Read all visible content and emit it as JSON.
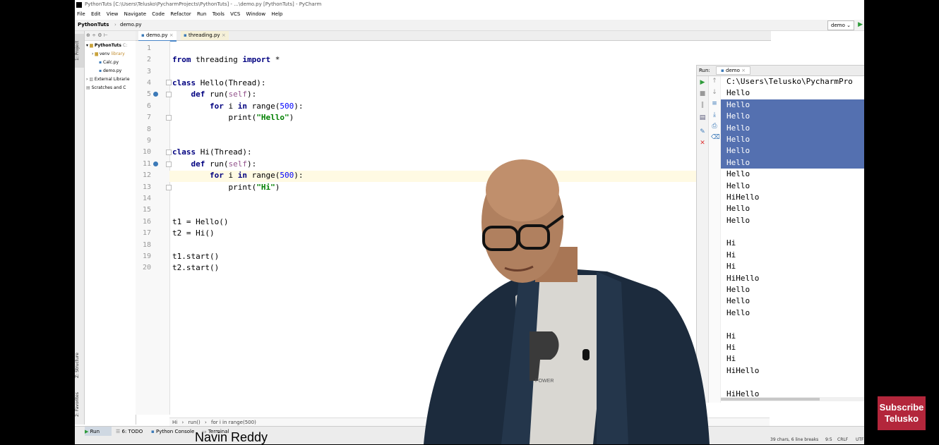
{
  "window": {
    "title": "PythonTuts [C:\\Users\\Telusko\\PycharmProjects\\PythonTuts] - ...\\demo.py [PythonTuts] - PyCharm"
  },
  "menu": [
    "File",
    "Edit",
    "View",
    "Navigate",
    "Code",
    "Refactor",
    "Run",
    "Tools",
    "VCS",
    "Window",
    "Help"
  ],
  "nav": {
    "project": "PythonTuts",
    "file": "demo.py",
    "run_config": "demo"
  },
  "side_tabs": {
    "project": "1: Project",
    "structure": "Z: Structure",
    "favorites": "2: Favorites"
  },
  "project_tree": {
    "root": "PythonTuts",
    "root_path": "C:",
    "venv": "venv",
    "venv_suffix": "library",
    "files": [
      "Calc.py",
      "demo.py"
    ],
    "external": "External Librarie",
    "scratches": "Scratches and C"
  },
  "editor_tabs": [
    {
      "label": "demo.py",
      "active": true
    },
    {
      "label": "threading.py",
      "active": false
    }
  ],
  "line_numbers": [
    "1",
    "2",
    "3",
    "4",
    "5",
    "6",
    "7",
    "8",
    "9",
    "10",
    "11",
    "12",
    "13",
    "14",
    "15",
    "16",
    "17",
    "18",
    "19",
    "20"
  ],
  "code": {
    "l2_a": "from",
    "l2_b": " threading ",
    "l2_c": "import",
    "l2_d": " *",
    "l4_a": "class",
    "l4_b": " Hello(Thread):",
    "l5_a": "def",
    "l5_b": " run(",
    "l5_c": "self",
    "l5_d": "):",
    "l6_a": "for",
    "l6_b": " i ",
    "l6_c": "in",
    "l6_d": " range(",
    "l6_e": "500",
    "l6_f": "):",
    "l7_a": "print(",
    "l7_b": "\"Hello\"",
    "l7_c": ")",
    "l10_a": "class",
    "l10_b": " Hi(Thread):",
    "l11_a": "def",
    "l11_b": " run(",
    "l11_c": "self",
    "l11_d": "):",
    "l12_a": "for",
    "l12_b": " i ",
    "l12_c": "in",
    "l12_d": " range(",
    "l12_e": "500",
    "l12_f": "):",
    "l13_a": "print(",
    "l13_b": "\"Hi\"",
    "l13_c": ")",
    "l16": "t1 = Hello()",
    "l17": "t2 = Hi()",
    "l19": "t1.start()",
    "l20": "t2.start()"
  },
  "editor_breadcrumb": [
    "Hi",
    "run()",
    "for i in range(500)"
  ],
  "run_panel": {
    "label": "Run:",
    "tab": "demo",
    "output": [
      {
        "text": "C:\\Users\\Telusko\\PycharmPro",
        "selected": false
      },
      {
        "text": "Hello",
        "selected": false
      },
      {
        "text": "Hello",
        "selected": true
      },
      {
        "text": "Hello",
        "selected": true
      },
      {
        "text": "Hello",
        "selected": true
      },
      {
        "text": "Hello",
        "selected": true
      },
      {
        "text": "Hello",
        "selected": true
      },
      {
        "text": "Hello",
        "selected": true
      },
      {
        "text": "Hello",
        "selected": false
      },
      {
        "text": "Hello",
        "selected": false
      },
      {
        "text": "HiHello",
        "selected": false
      },
      {
        "text": "Hello",
        "selected": false
      },
      {
        "text": "Hello",
        "selected": false
      },
      {
        "text": "",
        "selected": false
      },
      {
        "text": "Hi",
        "selected": false
      },
      {
        "text": "Hi",
        "selected": false
      },
      {
        "text": "Hi",
        "selected": false
      },
      {
        "text": "HiHello",
        "selected": false
      },
      {
        "text": "Hello",
        "selected": false
      },
      {
        "text": "Hello",
        "selected": false
      },
      {
        "text": "Hello",
        "selected": false
      },
      {
        "text": "",
        "selected": false
      },
      {
        "text": "Hi",
        "selected": false
      },
      {
        "text": "Hi",
        "selected": false
      },
      {
        "text": "Hi",
        "selected": false
      },
      {
        "text": "HiHello",
        "selected": false
      },
      {
        "text": "",
        "selected": false
      },
      {
        "text": "HiHello",
        "selected": false
      }
    ]
  },
  "bottom_tabs": [
    "Run",
    "6: TODO",
    "Python Console",
    "Terminal"
  ],
  "status": {
    "info": "39 chars, 6 line breaks",
    "position": "9:5",
    "line_sep": "CRLF",
    "encoding": "UTF"
  },
  "overlay": {
    "brand": "Telusko",
    "subscribe_line1": "Subscribe",
    "subscribe_line2": "Telusko",
    "presenter": "Navin Reddy",
    "shirt_logo_text": "POWER"
  },
  "colors": {
    "selection": "#5470b0",
    "keyword": "#000080",
    "string": "#008000",
    "subscribe_bg": "#b3263b"
  }
}
